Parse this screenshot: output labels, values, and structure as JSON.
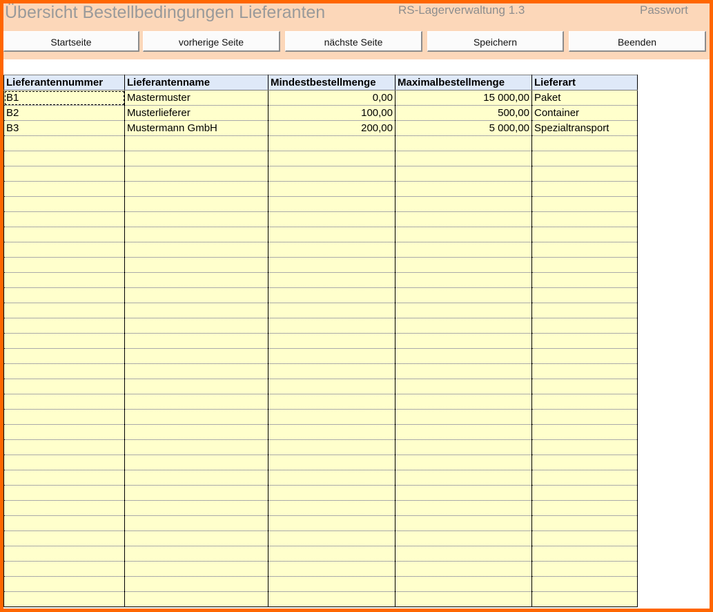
{
  "header": {
    "title": "Übersicht Bestellbedingungen Lieferanten",
    "app_name": "RS-Lagerverwaltung 1.3",
    "password_label": "Passwort"
  },
  "toolbar": {
    "start": "Startseite",
    "prev": "vorherige Seite",
    "next": "nächste Seite",
    "save": "Speichern",
    "quit": "Beenden"
  },
  "table": {
    "columns": [
      "Lieferantennummer",
      "Lieferantenname",
      "Mindestbestellmenge",
      "Maximalbestellmenge",
      "Lieferart"
    ],
    "rows": [
      [
        "B1",
        "Mastermuster",
        "0,00",
        "15 000,00",
        "Paket"
      ],
      [
        "B2",
        "Musterlieferer",
        "100,00",
        "500,00",
        "Container"
      ],
      [
        "B3",
        "Mustermann GmbH",
        "200,00",
        "5 000,00",
        "Spezialtransport"
      ]
    ],
    "empty_rows": 31
  },
  "colors": {
    "frame": "#ff6600",
    "header_band": "#fcd7b9",
    "cell_fill": "#ffffcc",
    "header_fill": "#dfe9f8"
  }
}
